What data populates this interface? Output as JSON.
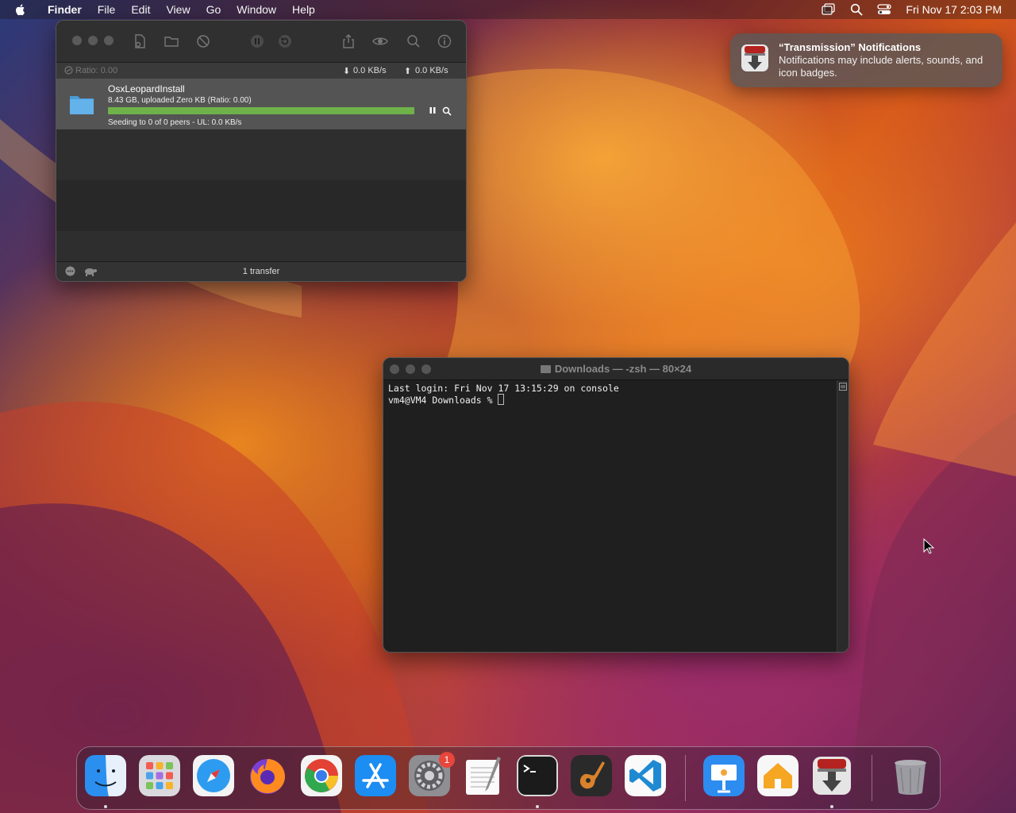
{
  "menubar": {
    "app_name": "Finder",
    "items": [
      "File",
      "Edit",
      "View",
      "Go",
      "Window",
      "Help"
    ],
    "clock": "Fri Nov 17  2:03 PM"
  },
  "transmission": {
    "ratio_label": "Ratio: 0.00",
    "download_rate": "0.0 KB/s",
    "upload_rate": "0.0 KB/s",
    "torrent": {
      "name": "OsxLeopardInstall",
      "info": "8.43 GB, uploaded Zero KB (Ratio: 0.00)",
      "status": "Seeding to 0 of 0 peers - UL: 0.0 KB/s",
      "progress": 1.0
    },
    "transfer_count": "1 transfer"
  },
  "notification": {
    "title": "“Transmission” Notifications",
    "body": "Notifications may include alerts, sounds, and icon badges."
  },
  "terminal": {
    "title": "Downloads — -zsh — 80×24",
    "line1": "Last login: Fri Nov 17 13:15:29 on console",
    "line2": "vm4@VM4 Downloads % "
  },
  "dock": {
    "settings_badge": "1",
    "apps": [
      "finder-icon",
      "launchpad-icon",
      "safari-icon",
      "firefox-icon",
      "chrome-icon",
      "app-store-icon",
      "system-settings-icon",
      "textedit-icon",
      "terminal-icon",
      "garageband-icon",
      "vscode-icon",
      "keynote-icon",
      "home-icon",
      "transmission-icon",
      "trash-icon"
    ]
  }
}
